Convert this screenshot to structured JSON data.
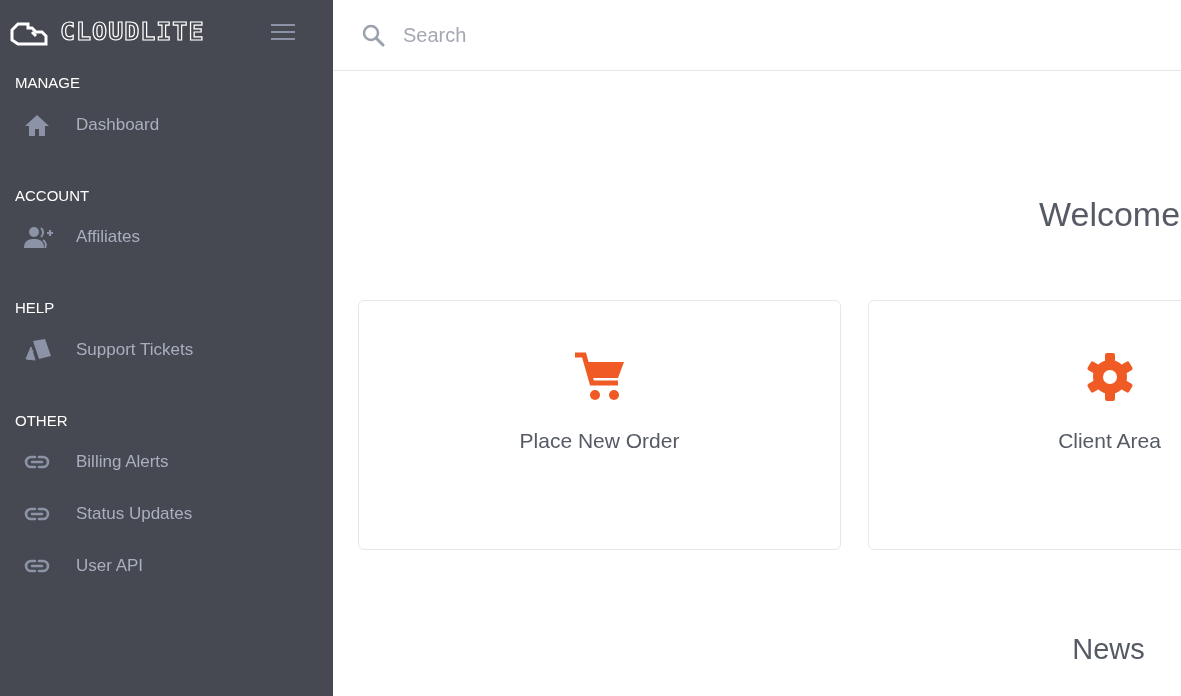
{
  "sidebar": {
    "logo": "CLOUDLITE",
    "sections": [
      {
        "heading": "MANAGE",
        "items": [
          {
            "label": "Dashboard",
            "kind": "home"
          }
        ]
      },
      {
        "heading": "ACCOUNT",
        "items": [
          {
            "label": "Affiliates",
            "kind": "user-add"
          }
        ]
      },
      {
        "heading": "HELP",
        "items": [
          {
            "label": "Support Tickets",
            "kind": "tickets"
          }
        ]
      },
      {
        "heading": "OTHER",
        "items": [
          {
            "label": "Billing Alerts",
            "kind": "link"
          },
          {
            "label": "Status Updates",
            "kind": "link"
          },
          {
            "label": "User API",
            "kind": "link"
          }
        ]
      }
    ]
  },
  "search": {
    "placeholder": "Search"
  },
  "welcome": "Welcome",
  "cards": [
    {
      "label": "Place New Order",
      "kind": "cart"
    },
    {
      "label": "Client Area",
      "kind": "gear"
    }
  ],
  "news": "News"
}
